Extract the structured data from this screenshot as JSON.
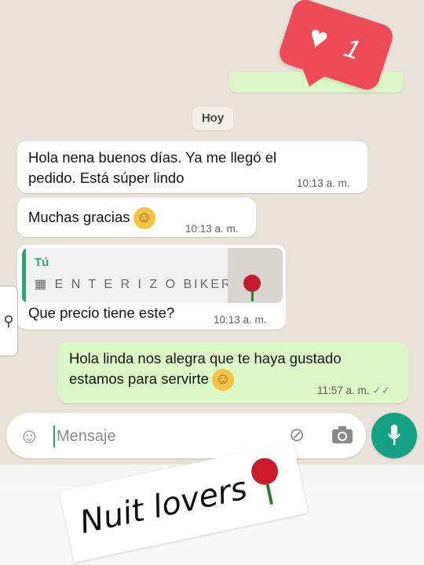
{
  "like_badge": {
    "count": "1",
    "icon": "heart-icon"
  },
  "date_chip": "Hoy",
  "messages": [
    {
      "direction": "in",
      "text": "Hola nena buenos días. Ya me llegó el pedido. Está súper lindo",
      "time": "10:13 a. m."
    },
    {
      "direction": "in",
      "text": "Muchas gracias",
      "emoji": "smiling-face-icon",
      "time": "10:13 a. m."
    },
    {
      "direction": "in",
      "quote": {
        "author": "Tú",
        "text": "E N T E R I Z O   BIKER",
        "icon": "store-icon"
      },
      "text": "Que precio tiene este?",
      "time": "10:13 a. m."
    },
    {
      "direction": "out",
      "text": "Hola linda nos alegra que te haya gustado estamos para servirte",
      "emoji": "relieved-face-icon",
      "time": "11:57 a. m.",
      "status": "read-double-check"
    }
  ],
  "input": {
    "placeholder": "Mensaje"
  },
  "sticker": {
    "text": "Nuit lovers"
  },
  "colors": {
    "accent": "#16a085",
    "outgoing_bubble": "#dcf8c6",
    "badge": "#ef4b57"
  }
}
